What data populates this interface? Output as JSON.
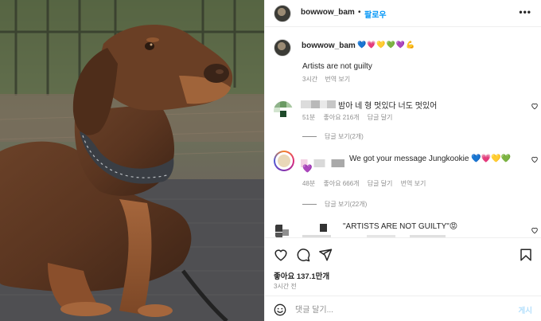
{
  "post": {
    "username": "bowwow_bam",
    "separator": "•",
    "follow_label": "팔로우",
    "more_label": "•••",
    "photo_icon": "dog-photo"
  },
  "caption": {
    "username": "bowwow_bam",
    "emojis": "💙💗💛💚💜💪",
    "text": "Artists are not guilty",
    "time": "3시간",
    "translate": "번역 보기"
  },
  "comments": [
    {
      "text": "밤아 네 형 멋있다 너도 멋있어",
      "time": "51분",
      "likes": "좋아요 216개",
      "reply": "답글 달기",
      "view_replies": "답글 보기(2개)"
    },
    {
      "text": "We got your message Jungkookie 💙💗💛💚",
      "text2": "💜",
      "time": "48분",
      "likes": "좋아요 666개",
      "reply": "답글 달기",
      "translate": "번역 보기",
      "view_replies": "답글 보기(22개)"
    },
    {
      "text": "\"ARTISTS ARE NOT GUILTY\"😡"
    }
  ],
  "actions": {
    "like_icon": "heart-icon",
    "comment_icon": "comment-icon",
    "share_icon": "share-icon",
    "save_icon": "bookmark-icon",
    "likes": "좋아요 137.1만개",
    "time_ago": "3시간 전"
  },
  "composer": {
    "placeholder": "댓글 달기...",
    "post_label": "게시",
    "emoji_icon": "smiley-icon"
  },
  "colors": {
    "accent": "#0095f6",
    "post_disabled": "#b2dffc",
    "muted": "#8e8e8e"
  }
}
